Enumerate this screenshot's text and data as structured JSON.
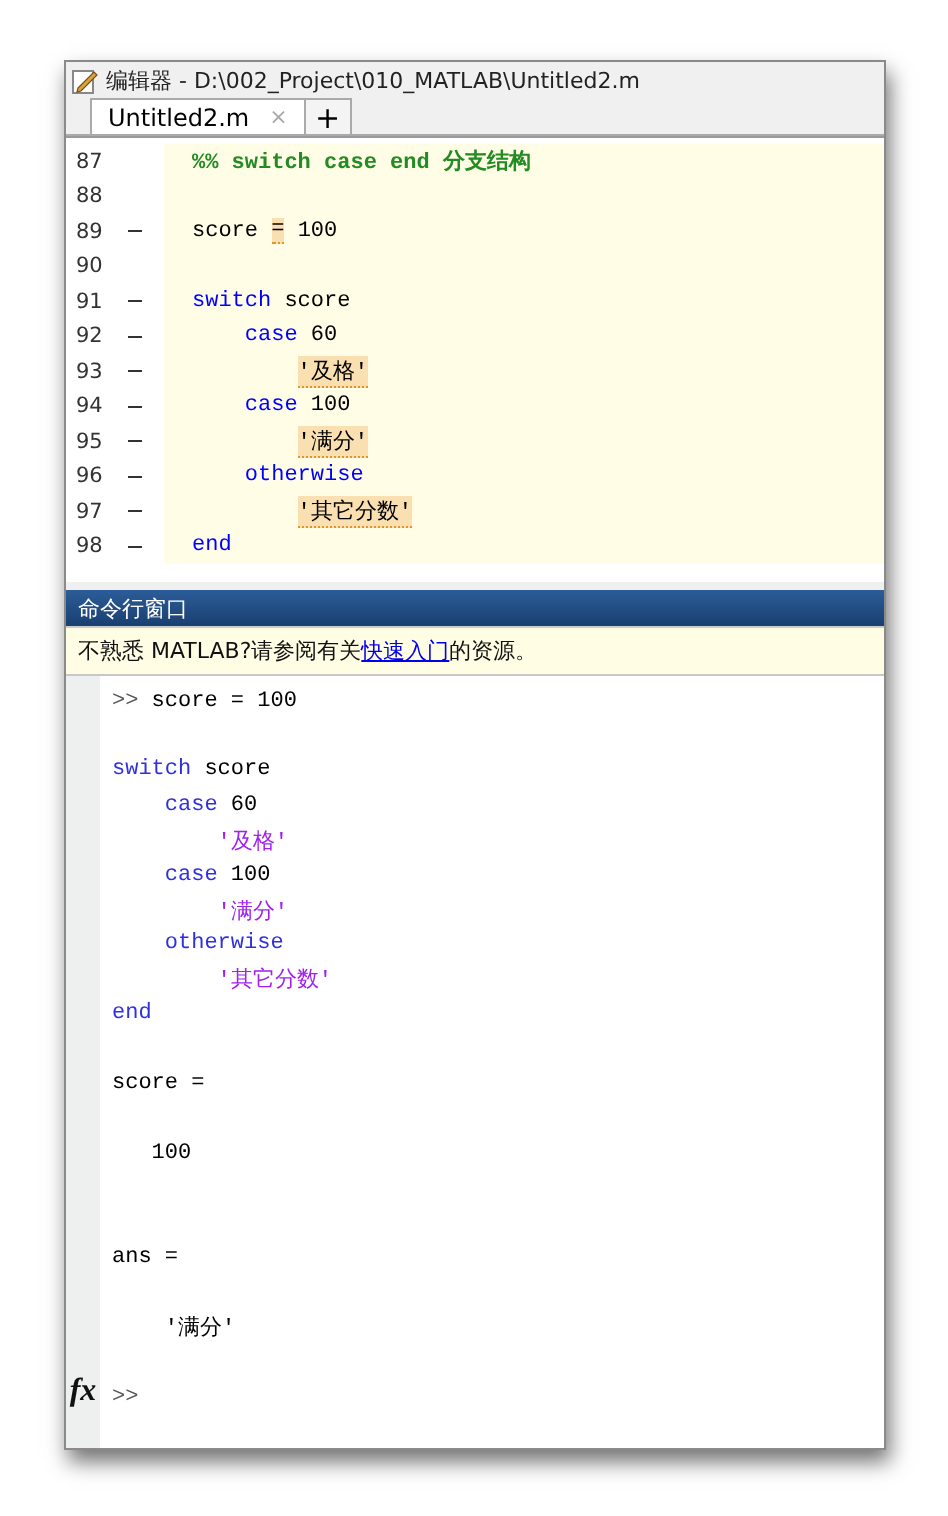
{
  "title_bar": {
    "title": "编辑器 - D:\\002_Project\\010_MATLAB\\Untitled2.m"
  },
  "tabs": [
    {
      "label": "Untitled2.m",
      "close": "×",
      "selected": true
    }
  ],
  "add_tab": "+",
  "editor": {
    "lines": [
      {
        "number": "87",
        "executable": false,
        "kind": "statement",
        "tokens": [
          {
            "kind": "comment",
            "text": "%% switch case end 分支结构",
            "flagged": false
          }
        ]
      },
      {
        "number": "88",
        "executable": false,
        "kind": "blank"
      },
      {
        "number": "89",
        "executable": true,
        "kind": "statement",
        "tokens": [
          {
            "kind": "plain",
            "text": "score ",
            "flagged": false
          },
          {
            "kind": "plain",
            "text": "=",
            "flagged": true
          },
          {
            "kind": "plain",
            "text": " 100",
            "flagged": false
          }
        ]
      },
      {
        "number": "90",
        "executable": false,
        "kind": "blank"
      },
      {
        "number": "91",
        "executable": true,
        "kind": "statement",
        "tokens": [
          {
            "kind": "keyword",
            "text": "switch",
            "flagged": false
          },
          {
            "kind": "plain",
            "text": " score",
            "flagged": false
          }
        ]
      },
      {
        "number": "92",
        "executable": true,
        "kind": "branch",
        "tokens": [
          {
            "kind": "keyword",
            "text": "case",
            "flagged": false
          },
          {
            "kind": "plain",
            "text": " 60",
            "flagged": false
          }
        ]
      },
      {
        "number": "93",
        "executable": true,
        "kind": "branch_body",
        "tokens": [
          {
            "kind": "plain",
            "text": "'及格'",
            "flagged": true
          }
        ]
      },
      {
        "number": "94",
        "executable": true,
        "kind": "branch",
        "tokens": [
          {
            "kind": "keyword",
            "text": "case",
            "flagged": false
          },
          {
            "kind": "plain",
            "text": " 100",
            "flagged": false
          }
        ]
      },
      {
        "number": "95",
        "executable": true,
        "kind": "branch_body",
        "tokens": [
          {
            "kind": "plain",
            "text": "'满分'",
            "flagged": true
          }
        ]
      },
      {
        "number": "96",
        "executable": true,
        "kind": "branch",
        "tokens": [
          {
            "kind": "keyword",
            "text": "otherwise",
            "flagged": false
          }
        ]
      },
      {
        "number": "97",
        "executable": true,
        "kind": "branch_body",
        "tokens": [
          {
            "kind": "plain",
            "text": "'其它分数'",
            "flagged": true
          }
        ]
      },
      {
        "number": "98",
        "executable": true,
        "kind": "statement",
        "tokens": [
          {
            "kind": "keyword",
            "text": "end",
            "flagged": false
          }
        ]
      }
    ]
  },
  "command_window": {
    "title": "命令行窗口",
    "notice": {
      "text_before": "不熟悉 MATLAB?请参阅有关",
      "link": "快速入门",
      "text_after": "的资源。"
    },
    "function_button": "fx",
    "lines": [
      {
        "kind": "statement",
        "tokens": [
          {
            "kind": "prompt",
            "text": ">>"
          },
          {
            "kind": "plain",
            "text": " score = 100"
          }
        ]
      },
      {
        "kind": "blank"
      },
      {
        "kind": "statement",
        "tokens": [
          {
            "kind": "keyword",
            "text": "switch"
          },
          {
            "kind": "plain",
            "text": " score"
          }
        ]
      },
      {
        "kind": "branch",
        "tokens": [
          {
            "kind": "keyword",
            "text": "case"
          },
          {
            "kind": "plain",
            "text": " 60"
          }
        ]
      },
      {
        "kind": "branch_body",
        "tokens": [
          {
            "kind": "string",
            "text": "'及格'"
          }
        ]
      },
      {
        "kind": "branch",
        "tokens": [
          {
            "kind": "keyword",
            "text": "case"
          },
          {
            "kind": "plain",
            "text": " 100"
          }
        ]
      },
      {
        "kind": "branch_body",
        "tokens": [
          {
            "kind": "string",
            "text": "'满分'"
          }
        ]
      },
      {
        "kind": "branch",
        "tokens": [
          {
            "kind": "keyword",
            "text": "otherwise"
          }
        ]
      },
      {
        "kind": "branch_body",
        "tokens": [
          {
            "kind": "string",
            "text": "'其它分数'"
          }
        ]
      },
      {
        "kind": "statement",
        "tokens": [
          {
            "kind": "keyword",
            "text": "end"
          }
        ]
      },
      {
        "kind": "blank"
      },
      {
        "kind": "statement",
        "tokens": [
          {
            "kind": "plain",
            "text": "score ="
          }
        ]
      },
      {
        "kind": "blank"
      },
      {
        "kind": "output",
        "tokens": [
          {
            "kind": "plain",
            "text": "100"
          }
        ]
      },
      {
        "kind": "blank"
      },
      {
        "kind": "blank"
      },
      {
        "kind": "statement",
        "tokens": [
          {
            "kind": "plain",
            "text": "ans ="
          }
        ]
      },
      {
        "kind": "blank"
      },
      {
        "kind": "branch",
        "tokens": [
          {
            "kind": "plain",
            "text": "'满分'"
          }
        ]
      },
      {
        "kind": "blank"
      },
      {
        "kind": "statement",
        "tokens": [
          {
            "kind": "prompt",
            "text": ">>"
          }
        ]
      }
    ]
  }
}
